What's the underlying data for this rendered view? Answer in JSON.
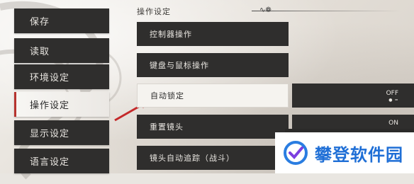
{
  "sidebar": {
    "items": [
      {
        "label": "保存"
      },
      {
        "label": "读取"
      },
      {
        "label": "环境设定"
      },
      {
        "label": "操作设定"
      },
      {
        "label": "显示设定"
      },
      {
        "label": "语言设定"
      }
    ]
  },
  "main": {
    "section_title": "操作设定",
    "rows": [
      {
        "label": "控制器操作"
      },
      {
        "label": "键盘与鼠标操作"
      },
      {
        "label": "自动锁定",
        "value": "OFF"
      },
      {
        "label": "重置镜头",
        "value": "ON"
      },
      {
        "label": "镜头自动追踪（战斗）"
      }
    ]
  },
  "watermark": {
    "text": "攀登软件园"
  },
  "colors": {
    "panel": "#2f2e2d",
    "active_bg": "#f5f3ef",
    "accent": "#b6342f",
    "watermark_blue": "#1f6fd6"
  }
}
